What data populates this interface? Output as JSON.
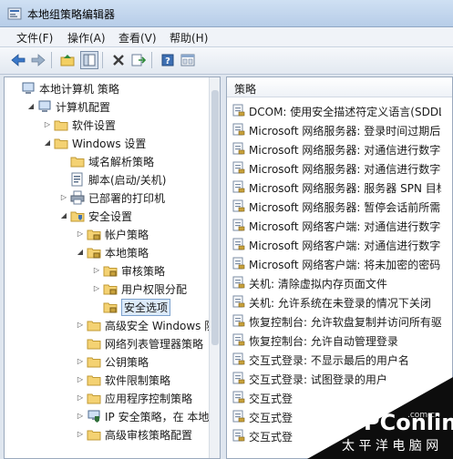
{
  "window": {
    "title": "本地组策略编辑器"
  },
  "menu": [
    "文件(F)",
    "操作(A)",
    "查看(V)",
    "帮助(H)"
  ],
  "tree": [
    {
      "label": "本地计算机 策略",
      "depth": 0,
      "arrow": "",
      "icon": "computer-icon"
    },
    {
      "label": "计算机配置",
      "depth": 1,
      "arrow": "down",
      "icon": "computer-icon"
    },
    {
      "label": "软件设置",
      "depth": 2,
      "arrow": "right",
      "icon": "folder-icon"
    },
    {
      "label": "Windows 设置",
      "depth": 2,
      "arrow": "down",
      "icon": "folder-icon"
    },
    {
      "label": "域名解析策略",
      "depth": 3,
      "arrow": "",
      "icon": "folder-icon"
    },
    {
      "label": "脚本(启动/关机)",
      "depth": 3,
      "arrow": "",
      "icon": "script-icon"
    },
    {
      "label": "已部署的打印机",
      "depth": 3,
      "arrow": "right",
      "icon": "printer-icon"
    },
    {
      "label": "安全设置",
      "depth": 3,
      "arrow": "down",
      "icon": "security-icon"
    },
    {
      "label": "帐户策略",
      "depth": 4,
      "arrow": "right",
      "icon": "folder-lock-icon"
    },
    {
      "label": "本地策略",
      "depth": 4,
      "arrow": "down",
      "icon": "folder-lock-icon"
    },
    {
      "label": "审核策略",
      "depth": 5,
      "arrow": "right",
      "icon": "folder-lock-icon"
    },
    {
      "label": "用户权限分配",
      "depth": 5,
      "arrow": "right",
      "icon": "folder-lock-icon"
    },
    {
      "label": "安全选项",
      "depth": 5,
      "arrow": "",
      "icon": "folder-lock-icon",
      "selected": true
    },
    {
      "label": "高级安全 Windows 防",
      "depth": 4,
      "arrow": "right",
      "icon": "folder-icon"
    },
    {
      "label": "网络列表管理器策略",
      "depth": 4,
      "arrow": "",
      "icon": "folder-icon"
    },
    {
      "label": "公钥策略",
      "depth": 4,
      "arrow": "right",
      "icon": "folder-icon"
    },
    {
      "label": "软件限制策略",
      "depth": 4,
      "arrow": "right",
      "icon": "folder-icon"
    },
    {
      "label": "应用程序控制策略",
      "depth": 4,
      "arrow": "right",
      "icon": "folder-icon"
    },
    {
      "label": "IP 安全策略，在 本地",
      "depth": 4,
      "arrow": "right",
      "icon": "ipsec-icon"
    },
    {
      "label": "高级审核策略配置",
      "depth": 4,
      "arrow": "right",
      "icon": "folder-icon"
    }
  ],
  "policy_header": "策略",
  "policies": [
    "DCOM: 使用安全描述符定义语言(SDDL)语",
    "Microsoft 网络服务器: 登录时间过期后断",
    "Microsoft 网络服务器: 对通信进行数字签",
    "Microsoft 网络服务器: 对通信进行数字签",
    "Microsoft 网络服务器: 服务器 SPN 目标",
    "Microsoft 网络服务器: 暂停会话前所需的",
    "Microsoft 网络客户端: 对通信进行数字签",
    "Microsoft 网络客户端: 对通信进行数字签",
    "Microsoft 网络客户端: 将未加密的密码发",
    "关机: 清除虚拟内存页面文件",
    "关机: 允许系统在未登录的情况下关闭",
    "恢复控制台: 允许软盘复制并访问所有驱动",
    "恢复控制台: 允许自动管理登录",
    "交互式登录: 不显示最后的用户名",
    "交互式登录: 试图登录的用户",
    "交互式登",
    "交互式登",
    "交互式登"
  ],
  "watermark": {
    "brand": "PConline",
    "domain": ".com.cn",
    "tagline": "太 平 洋 电 脑 网"
  }
}
